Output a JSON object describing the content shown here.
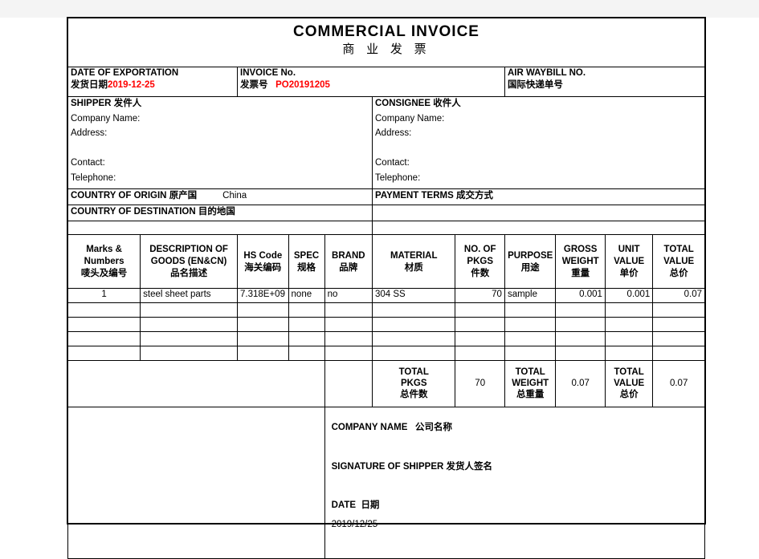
{
  "document": {
    "title_en": "COMMERCIAL   INVOICE",
    "title_cn": "商 业 发 票"
  },
  "header_fields": {
    "date_of_exportation": {
      "label_en": "DATE OF EXPORTATION",
      "label_cn": "发货日期",
      "value": "2019-12-25",
      "value_color": "#ff0000"
    },
    "invoice_no": {
      "label_en": "INVOICE No.",
      "label_cn": "发票号",
      "value": "PO20191205",
      "value_color": "#ff0000"
    },
    "air_waybill_no": {
      "label_en": "AIR WAYBILL NO.",
      "label_cn": "国际快递单号",
      "value": ""
    }
  },
  "shipper": {
    "heading_en": "SHIPPER",
    "heading_cn": "发件人",
    "company_name_label": "Company Name:",
    "company_name_value": "",
    "address_label": "Address:",
    "address_value": "",
    "contact_label": "Contact:",
    "contact_value": "",
    "telephone_label": "Telephone:",
    "telephone_value": ""
  },
  "consignee": {
    "heading_en": "CONSIGNEE",
    "heading_cn": "收件人",
    "company_name_label": "Company Name:",
    "company_name_value": "",
    "address_label": "Address:",
    "address_value": "",
    "contact_label": "Contact:",
    "contact_value": "",
    "telephone_label": "Telephone:",
    "telephone_value": ""
  },
  "origin_row": {
    "label_en": "COUNTRY OF ORIGIN",
    "label_cn": "原产国",
    "value": "China",
    "payment_terms_en": "PAYMENT TERMS",
    "payment_terms_cn": "成交方式",
    "payment_terms_value": ""
  },
  "destination_row": {
    "label_en": "COUNTRY OF DESTINATION",
    "label_cn": "目的地国",
    "value": ""
  },
  "goods_table": {
    "columns": [
      {
        "en": "Marks &\nNumbers",
        "en_line1": "Marks &",
        "en_line2": "Numbers",
        "cn": "唛头及编号"
      },
      {
        "en_line1": "DESCRIPTION OF",
        "en_line2": "GOODS   (EN&CN)",
        "cn": "品名描述"
      },
      {
        "en_line1": "HS Code",
        "en_line2": "",
        "cn": "海关编码"
      },
      {
        "en_line1": "SPEC",
        "en_line2": "",
        "cn": "规格"
      },
      {
        "en_line1": "BRAND",
        "en_line2": "",
        "cn": "品牌"
      },
      {
        "en_line1": "MATERIAL",
        "en_line2": "",
        "cn": "材质"
      },
      {
        "en_line1": "NO. OF",
        "en_line2": "PKGS",
        "cn": "件数"
      },
      {
        "en_line1": "PURPOSE",
        "en_line2": "",
        "cn": "用途"
      },
      {
        "en_line1": "GROSS",
        "en_line2": "WEIGHT",
        "cn": "重量"
      },
      {
        "en_line1": "UNIT",
        "en_line2": "VALUE",
        "cn": "单价"
      },
      {
        "en_line1": "TOTAL",
        "en_line2": "VALUE",
        "cn": "总价"
      }
    ],
    "rows": [
      {
        "marks": "1",
        "description": "steel sheet parts",
        "hs_code": "7.318E+09",
        "spec": "none",
        "brand": "no",
        "material": "304 SS",
        "no_of_pkgs": "70",
        "purpose": "sample",
        "gross_weight": "0.001",
        "unit_value": "0.001",
        "total_value": "0.07"
      },
      {
        "marks": "",
        "description": "",
        "hs_code": "",
        "spec": "",
        "brand": "",
        "material": "",
        "no_of_pkgs": "",
        "purpose": "",
        "gross_weight": "",
        "unit_value": "",
        "total_value": ""
      },
      {
        "marks": "",
        "description": "",
        "hs_code": "",
        "spec": "",
        "brand": "",
        "material": "",
        "no_of_pkgs": "",
        "purpose": "",
        "gross_weight": "",
        "unit_value": "",
        "total_value": ""
      },
      {
        "marks": "",
        "description": "",
        "hs_code": "",
        "spec": "",
        "brand": "",
        "material": "",
        "no_of_pkgs": "",
        "purpose": "",
        "gross_weight": "",
        "unit_value": "",
        "total_value": ""
      },
      {
        "marks": "",
        "description": "",
        "hs_code": "",
        "spec": "",
        "brand": "",
        "material": "",
        "no_of_pkgs": "",
        "purpose": "",
        "gross_weight": "",
        "unit_value": "",
        "total_value": ""
      }
    ],
    "totals": {
      "total_pkgs_en1": "TOTAL",
      "total_pkgs_en2": "PKGS",
      "total_pkgs_cn": "总件数",
      "total_pkgs_value": "70",
      "total_weight_en1": "TOTAL",
      "total_weight_en2": "WEIGHT",
      "total_weight_cn": "总重量",
      "total_weight_value": "0.07",
      "total_value_en1": "TOTAL",
      "total_value_en2": "VALUE",
      "total_value_cn": "总价",
      "total_value_value": "0.07"
    }
  },
  "signature_block": {
    "company_name_en": "COMPANY NAME",
    "company_name_cn": "公司名称",
    "signature_en": "SIGNATURE OF SHIPPER",
    "signature_cn": "发货人签名",
    "date_en": "DATE",
    "date_cn": "日期",
    "date_value": "2019/12/25"
  }
}
